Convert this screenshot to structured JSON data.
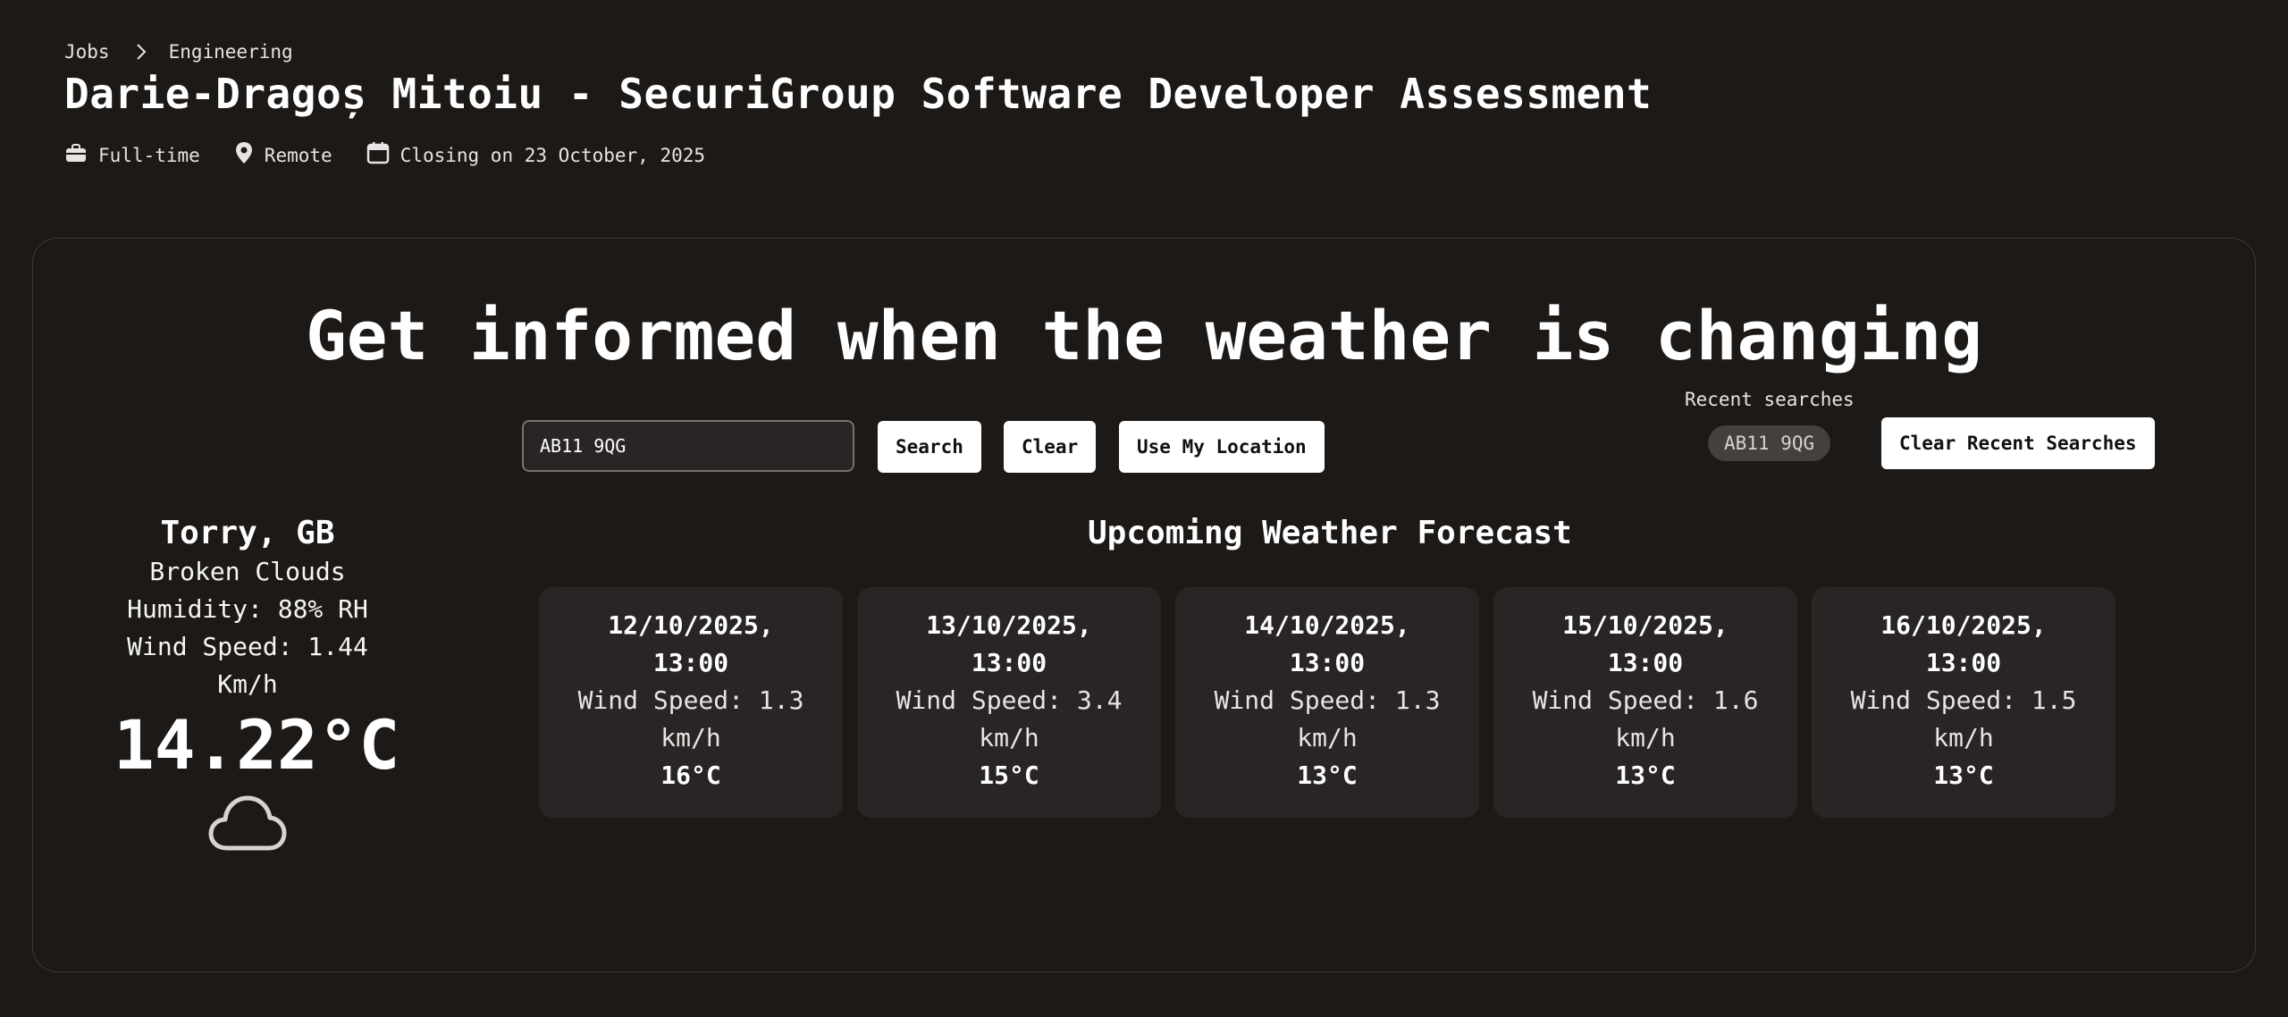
{
  "breadcrumb": {
    "items": [
      "Jobs",
      "Engineering"
    ]
  },
  "page": {
    "title": "Darie-Dragoș Mitoiu - SecuriGroup Software Developer Assessment",
    "meta": {
      "type": "Full-time",
      "location": "Remote",
      "closing": "Closing on 23 October, 2025"
    }
  },
  "app": {
    "headline": "Get informed when the weather is changing",
    "search": {
      "value": "AB11 9QG",
      "search_label": "Search",
      "clear_label": "Clear",
      "location_label": "Use My Location"
    },
    "recent": {
      "label": "Recent searches",
      "items": [
        "AB11 9QG"
      ],
      "clear_label": "Clear Recent Searches"
    },
    "current": {
      "city": "Torry, GB",
      "condition": "Broken Clouds",
      "humidity": "Humidity: 88% RH",
      "wind_line1": "Wind Speed: 1.44",
      "wind_line2": "Km/h",
      "temperature": "14.22°C",
      "icon": "cloud-icon"
    },
    "forecast": {
      "title": "Upcoming Weather Forecast",
      "days": [
        {
          "date": "12/10/2025,",
          "time": "13:00",
          "wind": "Wind Speed: 1.3",
          "unit": "km/h",
          "temp": "16°C"
        },
        {
          "date": "13/10/2025,",
          "time": "13:00",
          "wind": "Wind Speed: 3.4",
          "unit": "km/h",
          "temp": "15°C"
        },
        {
          "date": "14/10/2025,",
          "time": "13:00",
          "wind": "Wind Speed: 1.3",
          "unit": "km/h",
          "temp": "13°C"
        },
        {
          "date": "15/10/2025,",
          "time": "13:00",
          "wind": "Wind Speed: 1.6",
          "unit": "km/h",
          "temp": "13°C"
        },
        {
          "date": "16/10/2025,",
          "time": "13:00",
          "wind": "Wind Speed: 1.5",
          "unit": "km/h",
          "temp": "13°C"
        }
      ]
    }
  },
  "colors": {
    "background": "#1c1917",
    "card_border": "#3f3b38",
    "forecast_card": "#292524",
    "chip": "#44403c",
    "button": "#ffffff"
  }
}
